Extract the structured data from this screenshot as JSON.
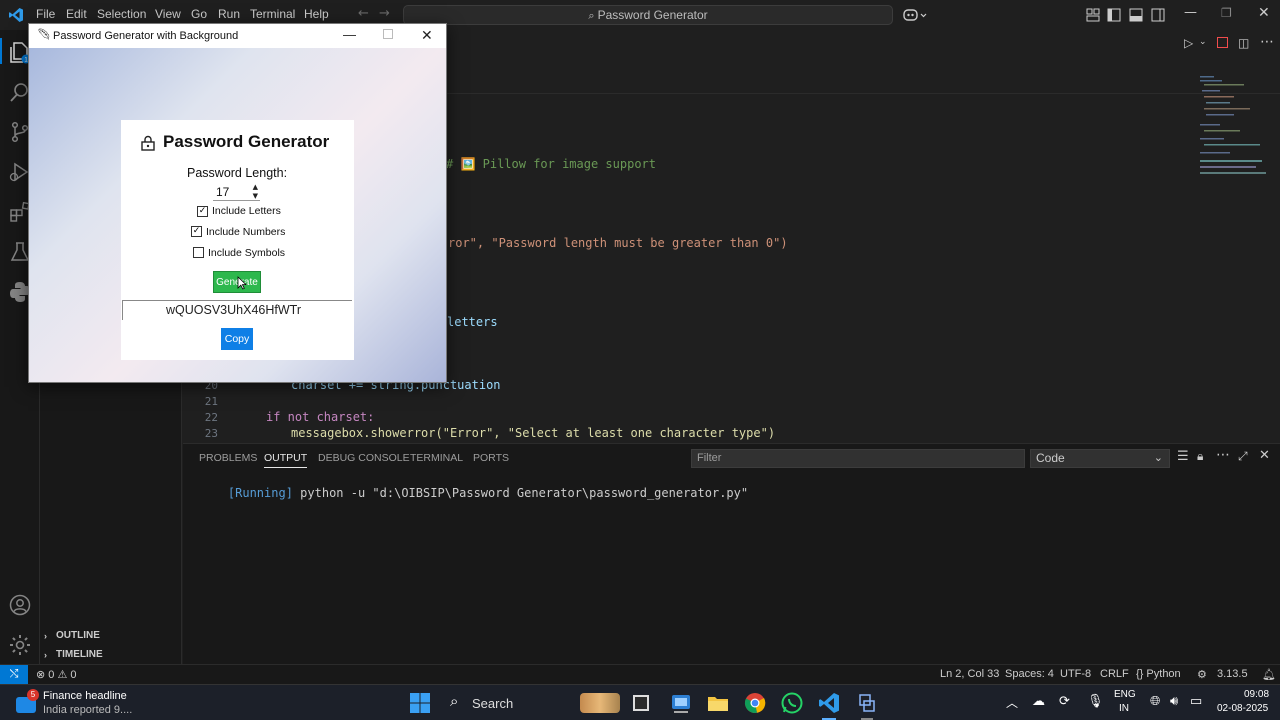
{
  "vscode": {
    "menu": [
      "File",
      "Edit",
      "Selection",
      "View",
      "Go",
      "Run",
      "Terminal",
      "Help"
    ],
    "command_center": "Password Generator",
    "sidebar_sections": [
      "OUTLINE",
      "TIMELINE"
    ],
    "code_fragments": {
      "comment": "# 🖼️ Pillow for image support",
      "error_line": "ror\", \"Password length must be greater than 0\")",
      "letters_line": "letters",
      "line20": "charset += string.punctuation",
      "line22": "if not charset:",
      "line23": "messagebox.showerror(\"Error\", \"Select at least one character type\")"
    },
    "line_numbers": [
      "20",
      "21",
      "22",
      "23"
    ],
    "panel": {
      "tabs": [
        "PROBLEMS",
        "OUTPUT",
        "DEBUG CONSOLE",
        "TERMINAL",
        "PORTS"
      ],
      "active_tab": "OUTPUT",
      "filter_placeholder": "Filter",
      "output_channel": "Code",
      "running_tag": "[Running]",
      "running_cmd": "python -u \"d:\\OIBSIP\\Password Generator\\password_generator.py\""
    },
    "status": {
      "errors": "0",
      "warnings": "0",
      "cursor": "Ln 2, Col 33",
      "spaces": "Spaces: 4",
      "encoding": "UTF-8",
      "eol": "CRLF",
      "language": "Python",
      "version": "3.13.5"
    }
  },
  "tk_window": {
    "title": "Password Generator with Background",
    "heading": "Password Generator",
    "length_label": "Password Length:",
    "length_value": "17",
    "options": [
      {
        "label": "Include Letters",
        "checked": true
      },
      {
        "label": "Include Numbers",
        "checked": true
      },
      {
        "label": "Include Symbols",
        "checked": false
      }
    ],
    "generate_label": "Generate",
    "password": "wQUOSV3UhX46HfWTr",
    "copy_label": "Copy"
  },
  "taskbar": {
    "news_title": "Finance headline",
    "news_sub": "India reported 9....",
    "news_badge": "5",
    "search_label": "Search",
    "lang_top": "ENG",
    "lang_bottom": "IN",
    "time": "09:08",
    "date": "02-08-2025"
  },
  "colors": {
    "accent_green": "#2db84d",
    "accent_blue": "#0f7fe6",
    "vscode_blue": "#0078d4"
  }
}
